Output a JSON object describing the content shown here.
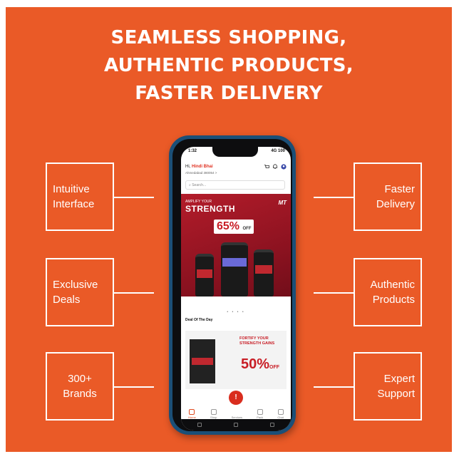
{
  "headline": {
    "line1": "SEAMLESS SHOPPING,",
    "line2": "AUTHENTIC PRODUCTS,",
    "line3": "FASTER DELIVERY"
  },
  "features": {
    "intuitive": {
      "line1": "Intuitive",
      "line2": "Interface"
    },
    "deals": {
      "line1": "Exclusive",
      "line2": "Deals"
    },
    "brands": {
      "line1": "300+",
      "line2": "Brands"
    },
    "delivery": {
      "line1": "Faster",
      "line2": "Delivery"
    },
    "authentic": {
      "line1": "Authentic",
      "line2": "Products"
    },
    "support": {
      "line1": "Expert",
      "line2": "Support"
    }
  },
  "colors": {
    "background": "#ea5a27",
    "accent": "#c81d25",
    "phone_frame": "#1b4f77"
  },
  "phone": {
    "status_time": "1:32",
    "status_right": "4G 100",
    "greeting_prefix": "Hi,",
    "greeting_name": "Hindi Bhai",
    "location": "Ahmedabad 380054 >",
    "search_placeholder": "Search...",
    "banner": {
      "small_text": "AMPLIFY YOUR",
      "big_text": "STRENGTH",
      "logo": "MT",
      "discount": "65%",
      "discount_suffix": "OFF"
    },
    "carousel_dots": "• • • •",
    "deal_title": "Deal Of The Day",
    "deal": {
      "line1": "FORTIFY YOUR",
      "line2": "STRENGTH GAINS",
      "discount": "50%",
      "discount_suffix": "OFF"
    },
    "tabs": [
      "Home",
      "Shop",
      "Services",
      "Pack",
      "Chat"
    ],
    "fab_icon": "lightning-icon"
  }
}
